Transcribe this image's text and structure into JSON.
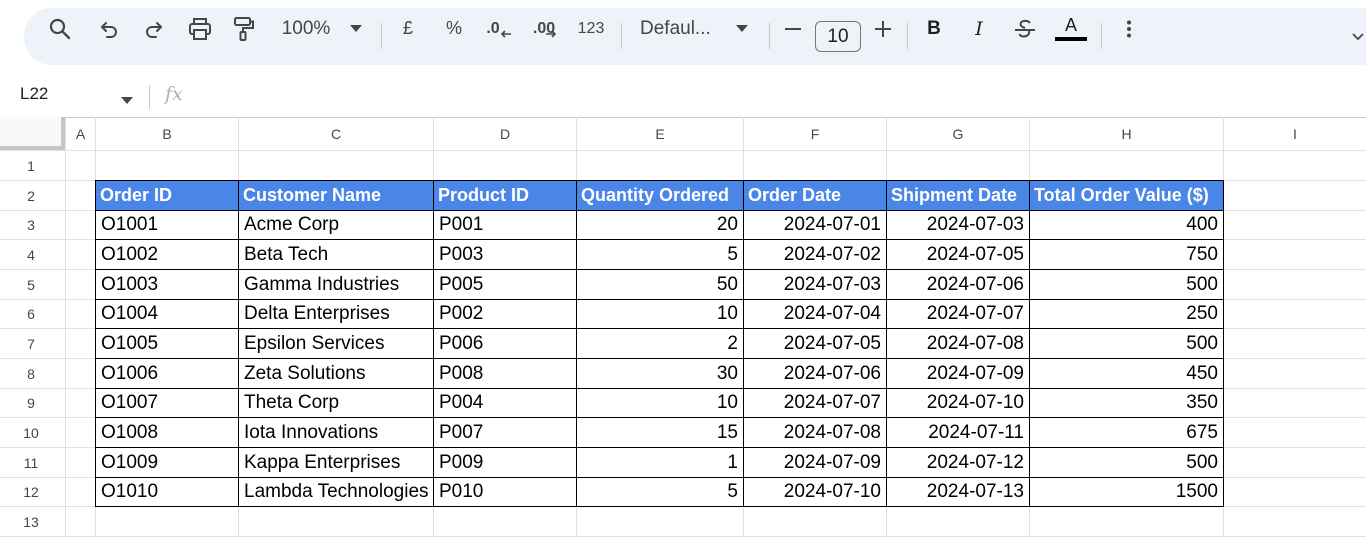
{
  "toolbar": {
    "zoom": "100%",
    "currency_symbol": "£",
    "percent_symbol": "%",
    "dec_decrease": ".0",
    "dec_increase": ".00",
    "format_123": "123",
    "font_name": "Defaul...",
    "font_size": "10",
    "bold": "B",
    "italic": "I",
    "text_color_letter": "A",
    "text_color": "#000000"
  },
  "formula_bar": {
    "cell_ref": "L22",
    "fx_label": "fx"
  },
  "columns": [
    "A",
    "B",
    "C",
    "D",
    "E",
    "F",
    "G",
    "H",
    "I"
  ],
  "rows": [
    "1",
    "2",
    "3",
    "4",
    "5",
    "6",
    "7",
    "8",
    "9",
    "10",
    "11",
    "12",
    "13"
  ],
  "table": {
    "header_color": "#4a86e8",
    "headers": [
      "Order ID",
      "Customer Name",
      "Product ID",
      "Quantity Ordered",
      "Order Date",
      "Shipment Date",
      "Total Order Value ($)"
    ],
    "rows": [
      [
        "O1001",
        "Acme Corp",
        "P001",
        "20",
        "2024-07-01",
        "2024-07-03",
        "400"
      ],
      [
        "O1002",
        "Beta Tech",
        "P003",
        "5",
        "2024-07-02",
        "2024-07-05",
        "750"
      ],
      [
        "O1003",
        "Gamma Industries",
        "P005",
        "50",
        "2024-07-03",
        "2024-07-06",
        "500"
      ],
      [
        "O1004",
        "Delta Enterprises",
        "P002",
        "10",
        "2024-07-04",
        "2024-07-07",
        "250"
      ],
      [
        "O1005",
        "Epsilon Services",
        "P006",
        "2",
        "2024-07-05",
        "2024-07-08",
        "500"
      ],
      [
        "O1006",
        "Zeta Solutions",
        "P008",
        "30",
        "2024-07-06",
        "2024-07-09",
        "450"
      ],
      [
        "O1007",
        "Theta Corp",
        "P004",
        "10",
        "2024-07-07",
        "2024-07-10",
        "350"
      ],
      [
        "O1008",
        "Iota Innovations",
        "P007",
        "15",
        "2024-07-08",
        "2024-07-11",
        "675"
      ],
      [
        "O1009",
        "Kappa Enterprises",
        "P009",
        "1",
        "2024-07-09",
        "2024-07-12",
        "500"
      ],
      [
        "O1010",
        "Lambda Technologies",
        "P010",
        "5",
        "2024-07-10",
        "2024-07-13",
        "1500"
      ]
    ]
  }
}
